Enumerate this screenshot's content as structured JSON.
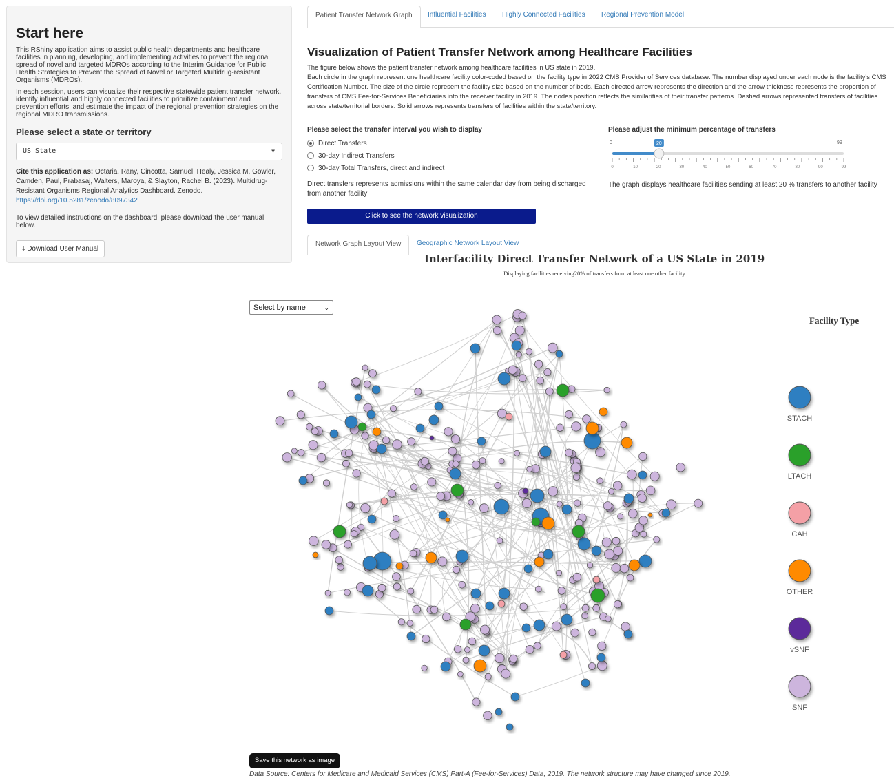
{
  "sidebar": {
    "heading": "Start here",
    "intro_p1": "This RShiny application aims to assist public health departments and healthcare facilities in planning, developing, and implementing activities to prevent the regional spread of novel and targeted MDROs according to the Interim Guidance for Public Health Strategies to Prevent the Spread of Novel or Targeted Multidrug-resistant Organisms (MDROs).",
    "intro_p2": "In each session, users can visualize their respective statewide patient transfer network, identify influential and highly connected facilities to prioritize containment and prevention efforts, and estimate the impact of the regional prevention strategies on the regional MDRO transmissions.",
    "state_label": "Please select a state or territory",
    "state_value": "US State",
    "cite_label": "Cite this application as:",
    "cite_text": " Octaria, Rany, Cincotta, Samuel, Healy, Jessica M, Gowler, Camden, Paul, Prabasaj, Walters, Maroya, & Slayton, Rachel B. (2023). Multidrug-Resistant Organisms Regional Analytics Dashboard. Zenodo.",
    "doi": "https://doi.org/10.5281/zenodo/8097342",
    "manual_note": "To view detailed instructions on the dashboard, please download the user manual below.",
    "download_label": "Download User Manual"
  },
  "tabs": [
    {
      "label": "Patient Transfer Network Graph",
      "active": true
    },
    {
      "label": "Influential Facilities",
      "active": false
    },
    {
      "label": "Highly Connected Facilities",
      "active": false
    },
    {
      "label": "Regional Prevention Model",
      "active": false
    }
  ],
  "main": {
    "title": "Visualization of Patient Transfer Network among Healthcare Facilities",
    "desc_line1": "The figure below shows the patient transfer network among healthcare facilities in US state in 2019.",
    "desc_rest": "Each circle in the graph represent one healthcare facility color-coded based on the facility type in 2022 CMS Provider of Services database. The number displayed under each node is the facility's CMS Certification Number. The size of the circle represent the facility size based on the number of beds. Each directed arrow represents the direction and the arrow thickness represents the proportion of transfers of CMS Fee-for-Services Beneficiaries into the receiver facility in 2019. The nodes position reflects the similarities of their transfer patterns. Dashed arrows represented transfers of facilities across state/territorial borders. Solid arrows represents transfers of facilities within the state/territory.",
    "interval_label": "Please select the transfer interval you wish to display",
    "interval_options": [
      "Direct Transfers",
      "30-day Indirect Transfers",
      "30-day Total Transfers, direct and indirect"
    ],
    "interval_note": "Direct transfers represents admissions within the same calendar day from being discharged from another facility",
    "slider_label": "Please adjust the minimum percentage of transfers",
    "slider_min": "0",
    "slider_max": "99",
    "slider_value": 20,
    "slider_value_label": "20",
    "slider_ticks": [
      "0",
      "10",
      "20",
      "30",
      "40",
      "50",
      "60",
      "70",
      "80",
      "90",
      "99"
    ],
    "slider_note": "The graph displays healthcare facilities sending at least 20 % transfers to another facility",
    "show_button": "Click to see the network visualization",
    "view_tabs": [
      {
        "label": "Network Graph Layout View",
        "active": true
      },
      {
        "label": "Geographic Network Layout View",
        "active": false
      }
    ]
  },
  "network": {
    "title": "Interfacility Direct Transfer Network of a US State in 2019",
    "subtitle": "Displaying facilities receiving20% of transfers from at least one other facility",
    "select_placeholder": "Select by name",
    "legend_title": "Facility Type",
    "legend": [
      {
        "label": "STACH",
        "color": "#2f7fc1"
      },
      {
        "label": "LTACH",
        "color": "#2ca02c"
      },
      {
        "label": "CAH",
        "color": "#f4a0a6"
      },
      {
        "label": "OTHER",
        "color": "#ff8a00"
      },
      {
        "label": "vSNF",
        "color": "#5b2c9a"
      },
      {
        "label": "SNF",
        "color": "#cdb5dd"
      }
    ],
    "save_button": "Save this network as image",
    "source": "Data Source: Centers for Medicare and Medicaid Services (CMS) Part-A (Fee-for-Services) Data, 2019. The network structure may have changed since 2019."
  }
}
